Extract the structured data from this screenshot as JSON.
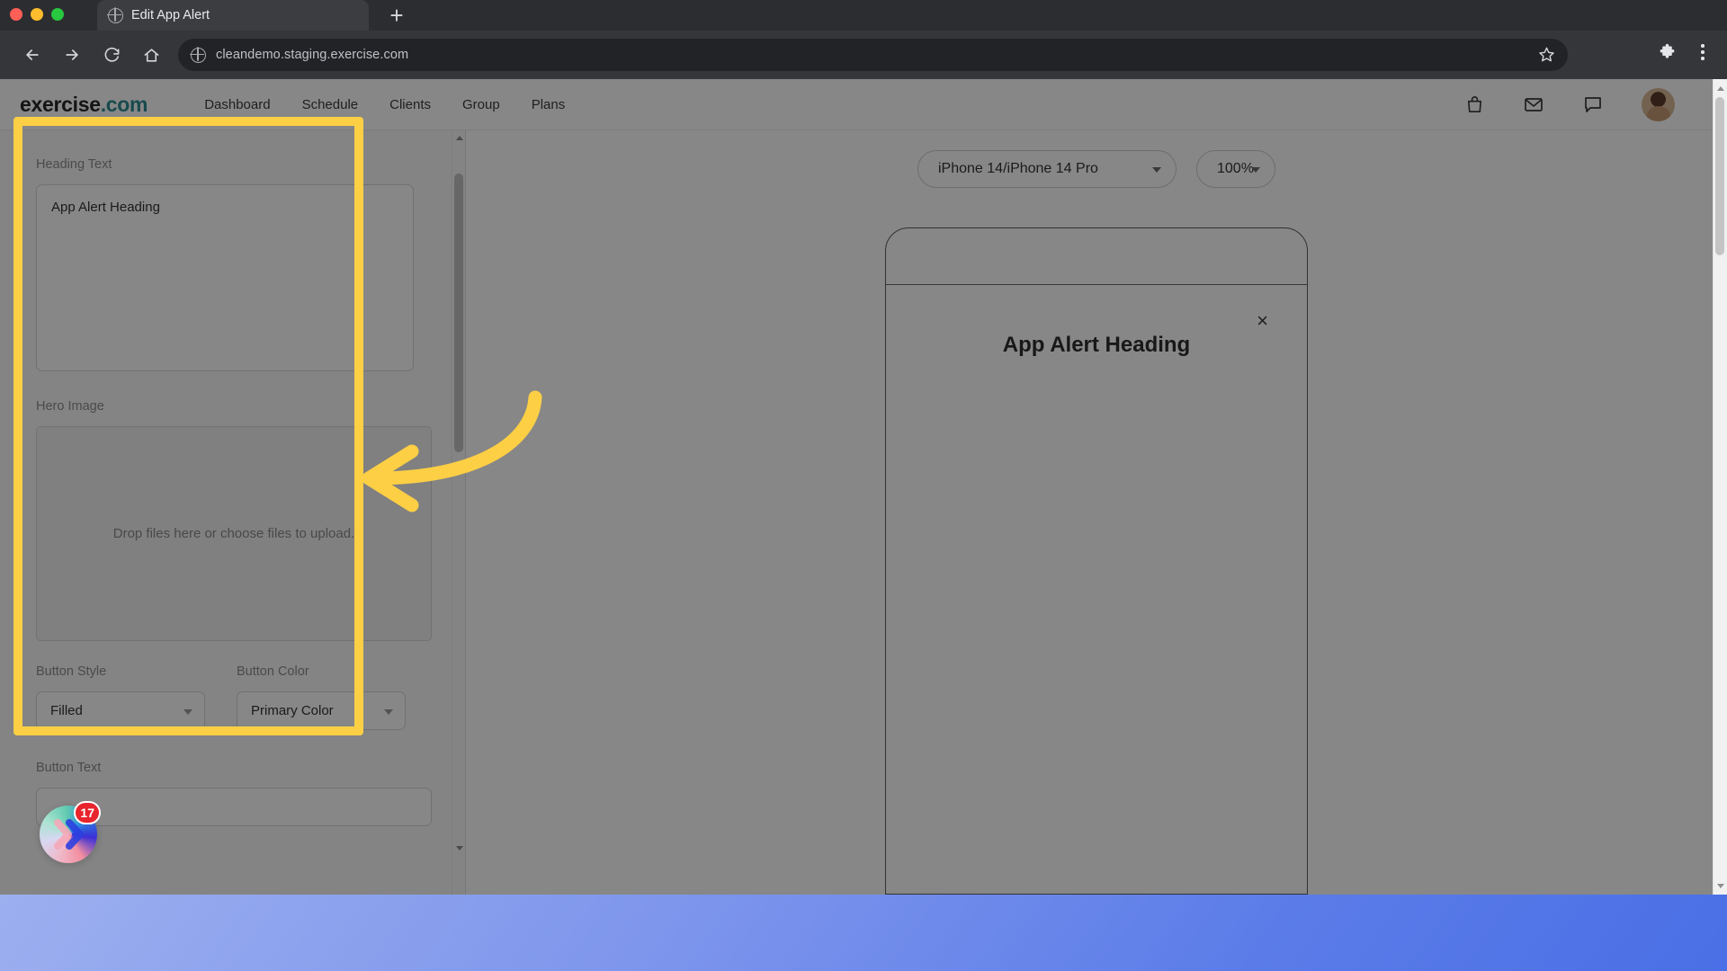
{
  "browser": {
    "tab_title": "Edit App Alert",
    "new_tab_label": "+",
    "url": "cleandemo.staging.exercise.com",
    "icons": {
      "back": "back-arrow-icon",
      "forward": "forward-arrow-icon",
      "reload": "reload-icon",
      "home": "home-icon",
      "bookmark": "star-icon",
      "extensions": "puzzle-icon",
      "menu": "three-dot-menu-icon"
    }
  },
  "appnav": {
    "brand_name": "exercise",
    "brand_suffix": ".com",
    "links": [
      {
        "label": "Dashboard"
      },
      {
        "label": "Schedule"
      },
      {
        "label": "Clients"
      },
      {
        "label": "Group"
      },
      {
        "label": "Plans"
      }
    ],
    "right_icons": [
      {
        "name": "shopping-bag-icon"
      },
      {
        "name": "envelope-icon"
      },
      {
        "name": "chat-bubble-icon"
      }
    ]
  },
  "editor": {
    "heading_text": {
      "label": "Heading Text",
      "value": "App Alert Heading"
    },
    "hero_image": {
      "label": "Hero Image",
      "dropzone_text": "Drop files here or choose files to upload."
    },
    "button_style": {
      "label": "Button Style",
      "value": "Filled"
    },
    "button_color": {
      "label": "Button Color",
      "value": "Primary Color"
    },
    "button_text": {
      "label": "Button Text",
      "value": ""
    }
  },
  "preview": {
    "device": "iPhone 14/iPhone 14 Pro",
    "zoom": "100%",
    "alert": {
      "heading": "App Alert Heading",
      "close_label": "×"
    }
  },
  "annotation": {
    "highlight_color": "#FCCF45",
    "arrow_color": "#FCCF45"
  },
  "widget": {
    "badge_count": "17"
  }
}
